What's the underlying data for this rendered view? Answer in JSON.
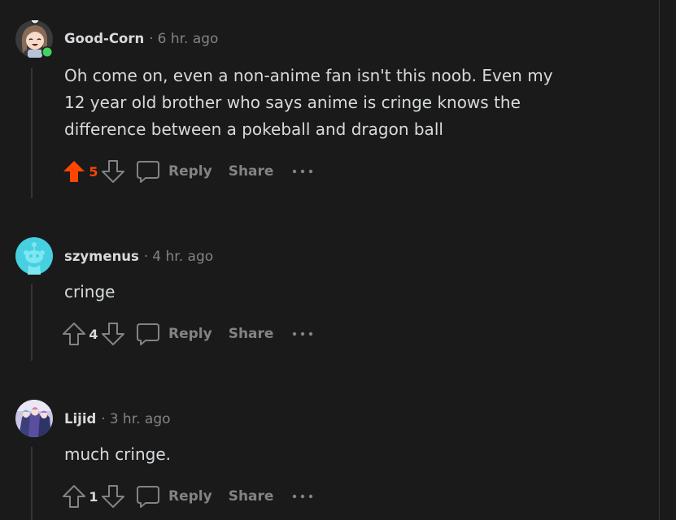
{
  "colors": {
    "background": "#1a1a1b",
    "text": "#d7dadc",
    "muted": "#818384",
    "upvote_active": "#ff4500",
    "thread_line": "#343536"
  },
  "actions": {
    "reply_label": "Reply",
    "share_label": "Share",
    "more_icon": "ellipsis-icon"
  },
  "comments": [
    {
      "username": "Good-Corn",
      "separator": "·",
      "time": "6 hr. ago",
      "lines": [
        "Oh come on, even a non-anime fan isn't this noob. Even my",
        "12 year old brother who says anime is cringe knows the",
        "difference between a pokeball and dragon ball"
      ],
      "score": "5",
      "upvoted": true,
      "avatar": "cartoon-girl-avatar",
      "online": true
    },
    {
      "username": "szymenus",
      "separator": "·",
      "time": "4 hr. ago",
      "lines": [
        "cringe"
      ],
      "score": "4",
      "upvoted": false,
      "avatar": "default-snoo-avatar",
      "online": false
    },
    {
      "username": "Lijid",
      "separator": "·",
      "time": "3 hr. ago",
      "lines": [
        "much cringe."
      ],
      "score": "1",
      "upvoted": false,
      "avatar": "anime-art-avatar",
      "online": false
    }
  ]
}
